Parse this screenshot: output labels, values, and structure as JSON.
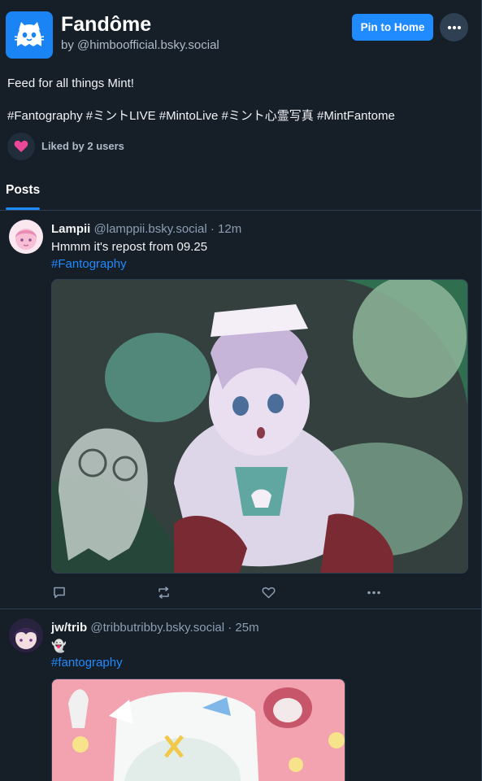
{
  "feed": {
    "title": "Fandôme",
    "byline": "by @himboofficial.bsky.social",
    "description": "Feed for all things Mint!",
    "hashtags": "#Fantography #ミントLIVE #MintoLive #ミント心霊写真 #MintFantome",
    "liked_by": "Liked by 2 users",
    "pin_label": "Pin to Home",
    "avatar_icon": "ghost-cat-icon",
    "accent": "#208bfe",
    "heart_color": "#ec4899"
  },
  "tabs": [
    {
      "label": "Posts"
    }
  ],
  "posts": [
    {
      "author": "Lampii",
      "handle": "@lamppii.bsky.social · 12m",
      "text": "Hmmm it's repost from 09.25",
      "tag": "#Fantography",
      "image_description": "illustration"
    },
    {
      "author": "jw/trib",
      "handle": "@tribbutribby.bsky.social · 25m",
      "text": "👻",
      "tag": "#fantography",
      "image_description": "illustration"
    }
  ]
}
